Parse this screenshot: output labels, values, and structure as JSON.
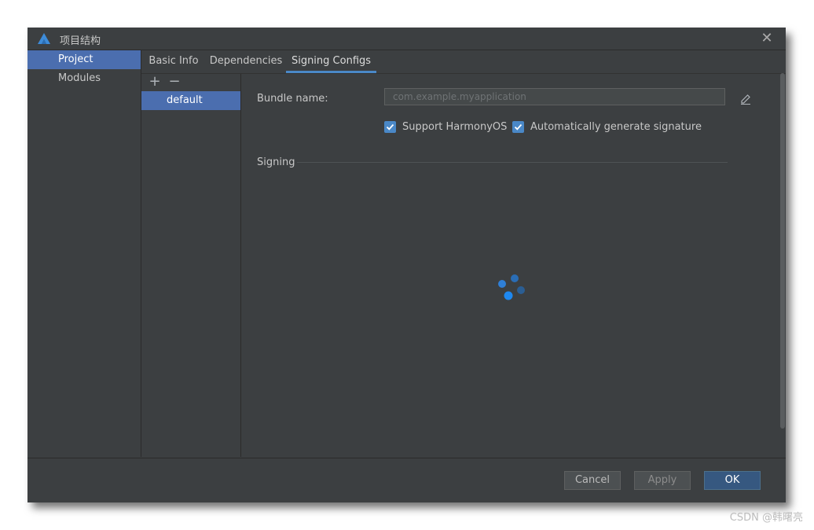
{
  "window": {
    "title": "项目结构",
    "close_icon": "close-icon"
  },
  "sidebar": {
    "items": [
      {
        "label": "Project",
        "selected": true
      },
      {
        "label": "Modules",
        "selected": false
      }
    ]
  },
  "tabs": [
    {
      "label": "Basic Info",
      "active": false
    },
    {
      "label": "Dependencies",
      "active": false
    },
    {
      "label": "Signing Configs",
      "active": true
    }
  ],
  "list": {
    "add_label": "+",
    "remove_label": "−",
    "items": [
      {
        "label": "default",
        "selected": true
      }
    ]
  },
  "form": {
    "bundle_label": "Bundle name:",
    "bundle_placeholder": "com.example.myapplication",
    "edit_icon": "pencil-icon",
    "support_harmony": {
      "label": "Support HarmonyOS",
      "checked": true
    },
    "auto_signature": {
      "label": "Automatically generate signature",
      "checked": true
    }
  },
  "signing": {
    "title": "Signing",
    "loading": true
  },
  "footer": {
    "cancel_label": "Cancel",
    "apply_label": "Apply",
    "ok_label": "OK"
  },
  "watermark": "CSDN @韩曙亮",
  "colors": {
    "accent": "#4a88c7",
    "selection": "#4b6eaf",
    "background": "#3c3f41"
  }
}
